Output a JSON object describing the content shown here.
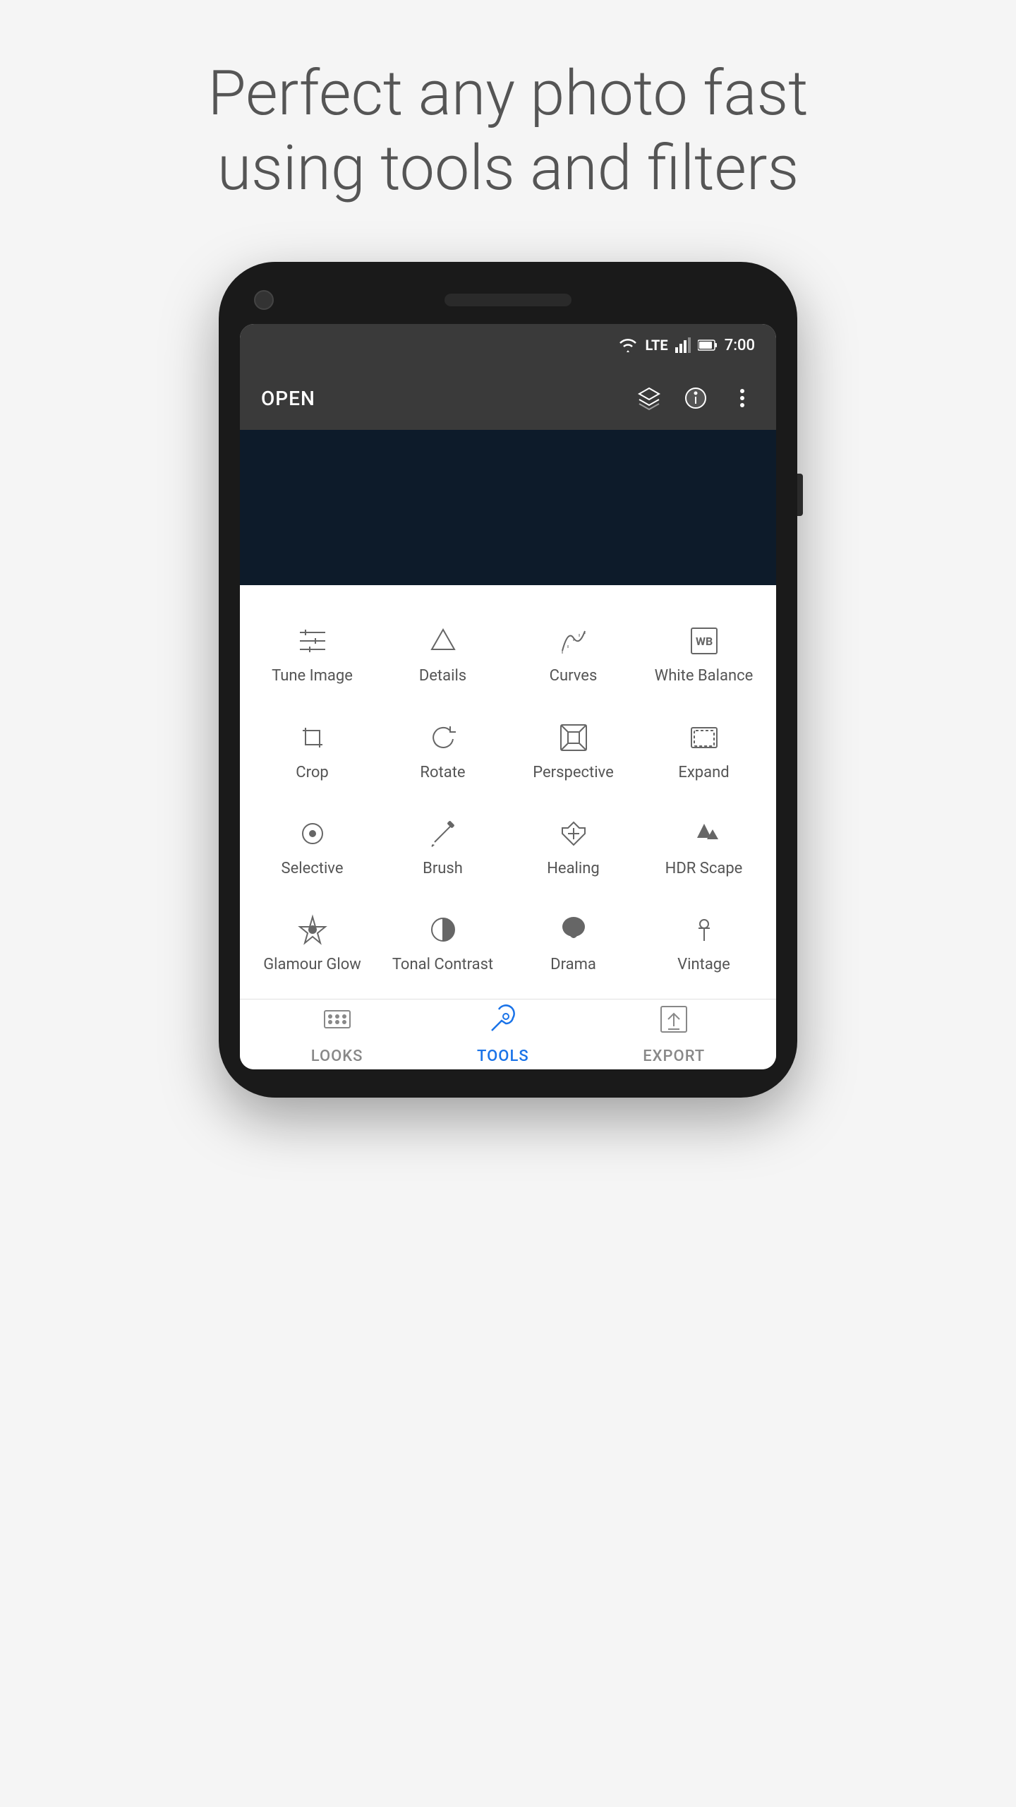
{
  "headline": {
    "line1": "Perfect any photo fast",
    "line2": "using tools and filters"
  },
  "status_bar": {
    "time": "7:00",
    "lte": "LTE"
  },
  "app_bar": {
    "open_label": "OPEN"
  },
  "tools": [
    {
      "id": "tune-image",
      "label": "Tune Image",
      "icon": "tune"
    },
    {
      "id": "details",
      "label": "Details",
      "icon": "details"
    },
    {
      "id": "curves",
      "label": "Curves",
      "icon": "curves"
    },
    {
      "id": "white-balance",
      "label": "White Balance",
      "icon": "wb"
    },
    {
      "id": "crop",
      "label": "Crop",
      "icon": "crop"
    },
    {
      "id": "rotate",
      "label": "Rotate",
      "icon": "rotate"
    },
    {
      "id": "perspective",
      "label": "Perspective",
      "icon": "perspective"
    },
    {
      "id": "expand",
      "label": "Expand",
      "icon": "expand"
    },
    {
      "id": "selective",
      "label": "Selective",
      "icon": "selective"
    },
    {
      "id": "brush",
      "label": "Brush",
      "icon": "brush"
    },
    {
      "id": "healing",
      "label": "Healing",
      "icon": "healing"
    },
    {
      "id": "hdr-scape",
      "label": "HDR Scape",
      "icon": "hdr"
    },
    {
      "id": "glamour-glow",
      "label": "Glamour Glow",
      "icon": "glamour"
    },
    {
      "id": "tonal-contrast",
      "label": "Tonal Contrast",
      "icon": "tonal"
    },
    {
      "id": "drama",
      "label": "Drama",
      "icon": "drama"
    },
    {
      "id": "vintage",
      "label": "Vintage",
      "icon": "vintage"
    }
  ],
  "bottom_nav": [
    {
      "id": "looks",
      "label": "LOOKS",
      "active": false
    },
    {
      "id": "tools",
      "label": "TOOLS",
      "active": true
    },
    {
      "id": "export",
      "label": "EXPORT",
      "active": false
    }
  ]
}
